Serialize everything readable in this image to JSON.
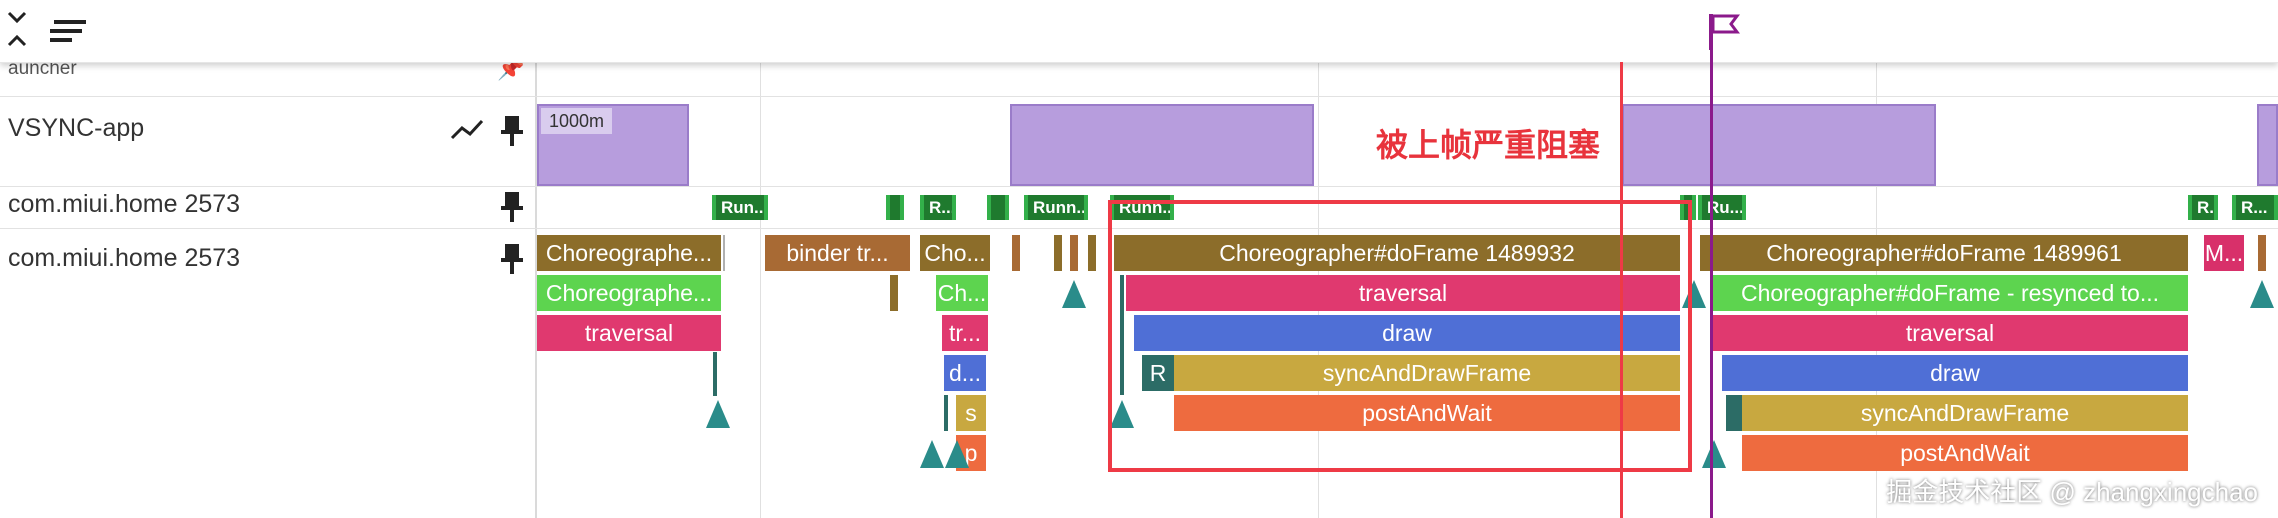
{
  "header": {
    "expand_icon": "collapse-expand-icon",
    "menu_icon": "menu-icon"
  },
  "tracks": [
    {
      "label": "auncher"
    },
    {
      "label": "VSYNC-app"
    },
    {
      "label": "com.miui.home 2573"
    },
    {
      "label": "com.miui.home 2573"
    }
  ],
  "vsync": {
    "tag": "1000m"
  },
  "annotation": {
    "text": "被上帧严重阻塞",
    "color": "#e8333c"
  },
  "chips": [
    "Run...",
    "R...",
    "Runn...",
    "Runn...",
    "Ru...",
    "R...",
    "R..."
  ],
  "slices": {
    "frame1": [
      "Choreographe...",
      "Choreographe...",
      "traversal"
    ],
    "binder": "binder tr...",
    "frame2": [
      "Cho...",
      "Ch...",
      "tr...",
      "d...",
      "s",
      "p"
    ],
    "frame3": [
      "Choreographer#doFrame 1489932",
      "traversal",
      "draw",
      "R",
      "syncAndDrawFrame",
      "postAndWait"
    ],
    "frame4": [
      "Choreographer#doFrame 1489961",
      "Choreographer#doFrame - resynced to...",
      "traversal",
      "draw",
      "syncAndDrawFrame",
      "postAndWait"
    ],
    "m": "M..."
  },
  "watermark": "掘金技术社区 @ zhangxingchao",
  "colors": {
    "choreographer": "#8c6d2a",
    "resynced": "#5dd44f",
    "traversal": "#e0396f",
    "draw": "#4f6fd6",
    "sync": "#c8a840",
    "post": "#ee6b3f",
    "vsync": "#b79ddd",
    "marker": "#8b1a8b"
  }
}
